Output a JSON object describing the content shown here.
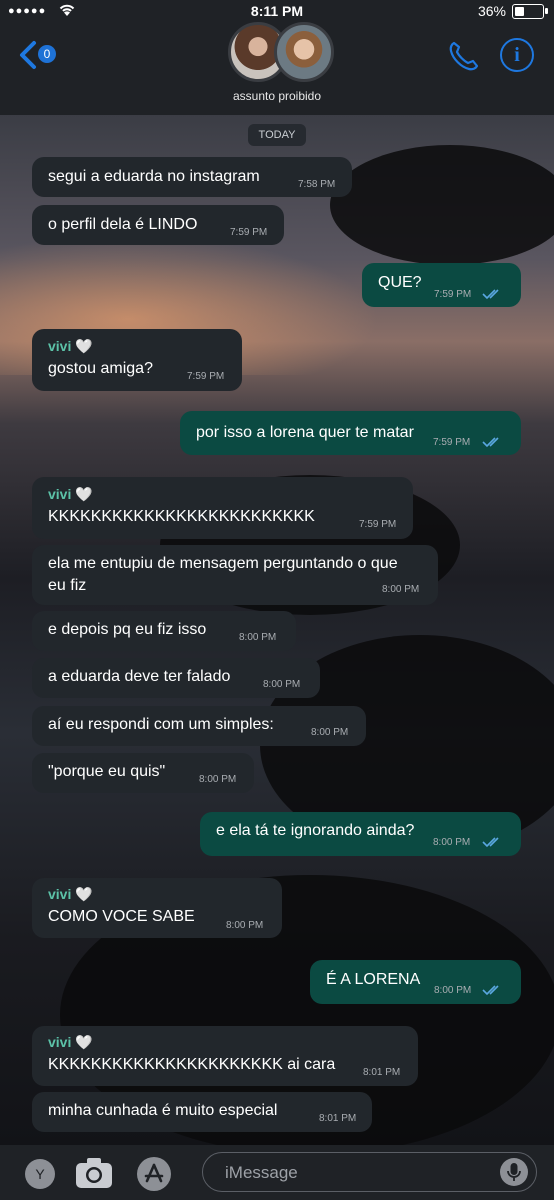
{
  "status": {
    "dots": "●●●●●",
    "time": "8:11 PM",
    "battery_pct": "36%",
    "battery_level": 0.36
  },
  "header": {
    "back_badge": "0",
    "title": "assunto proibido"
  },
  "day_label": "TODAY",
  "messages": [
    {
      "dir": "in",
      "text": "segui a eduarda no instagram",
      "time": "7:58 PM"
    },
    {
      "dir": "in",
      "text": "o perfil dela é LINDO",
      "time": "7:59 PM"
    },
    {
      "dir": "out",
      "text": "QUE?",
      "time": "7:59 PM"
    },
    {
      "dir": "in",
      "sender": "vivi 🤍",
      "text": "gostou amiga?",
      "time": "7:59 PM"
    },
    {
      "dir": "out",
      "text": "por isso a lorena quer te matar",
      "time": "7:59 PM"
    },
    {
      "dir": "in",
      "sender": "vivi 🤍",
      "text": "KKKKKKKKKKKKKKKKKKKKKKKKK",
      "time": "7:59 PM"
    },
    {
      "dir": "in",
      "text": "ela me entupiu de mensagem perguntando o que",
      "text2": "eu fiz",
      "time": "8:00 PM"
    },
    {
      "dir": "in",
      "text": "e depois pq eu fiz isso",
      "time": "8:00 PM"
    },
    {
      "dir": "in",
      "text": "a eduarda deve ter falado",
      "time": "8:00 PM"
    },
    {
      "dir": "in",
      "text": "aí eu respondi com um simples:",
      "time": "8:00 PM"
    },
    {
      "dir": "in",
      "text": "\"porque eu quis\"",
      "time": "8:00 PM"
    },
    {
      "dir": "out",
      "text": "e ela tá te ignorando ainda?",
      "time": "8:00 PM"
    },
    {
      "dir": "in",
      "sender": "vivi 🤍",
      "text": "COMO VOCE SABE",
      "time": "8:00 PM"
    },
    {
      "dir": "out",
      "text": "É A LORENA",
      "time": "8:00 PM"
    },
    {
      "dir": "in",
      "sender": "vivi 🤍",
      "text": "KKKKKKKKKKKKKKKKKKKKKK ai cara",
      "time": "8:01 PM"
    },
    {
      "dir": "in",
      "text": "minha cunhada é muito especial",
      "time": "8:01 PM"
    }
  ],
  "input": {
    "avatar_letter": "Y",
    "placeholder": "iMessage"
  },
  "colors": {
    "accent": "#1e78e0",
    "incoming": "#22272c",
    "outgoing": "#0b4a42",
    "sender": "#5cc2a8"
  }
}
